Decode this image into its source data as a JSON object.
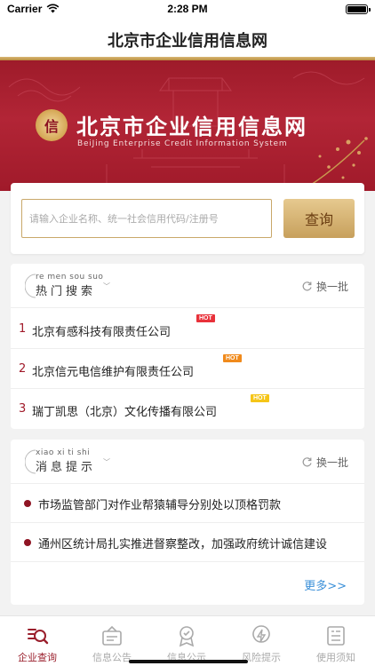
{
  "status": {
    "carrier": "Carrier",
    "time": "2:28 PM"
  },
  "nav": {
    "title": "北京市企业信用信息网"
  },
  "banner": {
    "logo_glyph": "信",
    "title": "北京市企业信用信息网",
    "subtitle": "BeiJing Enterprise Credit Information System"
  },
  "search": {
    "placeholder": "请输入企业名称、统一社会信用代码/注册号",
    "button_label": "查询"
  },
  "hot": {
    "pinyin": "re men sou suo",
    "title": "热门搜索",
    "refresh_label": "换一批",
    "items": [
      {
        "rank": "1",
        "name": "北京有感科技有限责任公司",
        "badge": "HOT",
        "badge_color": "#e8313a"
      },
      {
        "rank": "2",
        "name": "北京信元电信维护有限责任公司",
        "badge": "HOT",
        "badge_color": "#f08a1c"
      },
      {
        "rank": "3",
        "name": "瑞丁凯思（北京）文化传播有限公司",
        "badge": "HOT",
        "badge_color": "#f5c518"
      }
    ]
  },
  "news": {
    "pinyin": "xiao xi ti shi",
    "title": "消息提示",
    "refresh_label": "换一批",
    "items": [
      {
        "text": "市场监管部门对作业帮猿辅导分别处以顶格罚款"
      },
      {
        "text": "通州区统计局扎实推进督察整改，加强政府统计诚信建设"
      }
    ],
    "more_label": "更多>>"
  },
  "tabs": [
    {
      "label": "企业查询",
      "icon": "search-list-icon",
      "active": true
    },
    {
      "label": "信息公告",
      "icon": "bulletin-icon",
      "active": false
    },
    {
      "label": "信息公示",
      "icon": "badge-icon",
      "active": false
    },
    {
      "label": "风险提示",
      "icon": "lightning-icon",
      "active": false
    },
    {
      "label": "使用须知",
      "icon": "document-icon",
      "active": false
    }
  ],
  "colors": {
    "brand_red": "#a01a2a",
    "gold": "#c7a05c",
    "link_blue": "#3a8fd8"
  }
}
